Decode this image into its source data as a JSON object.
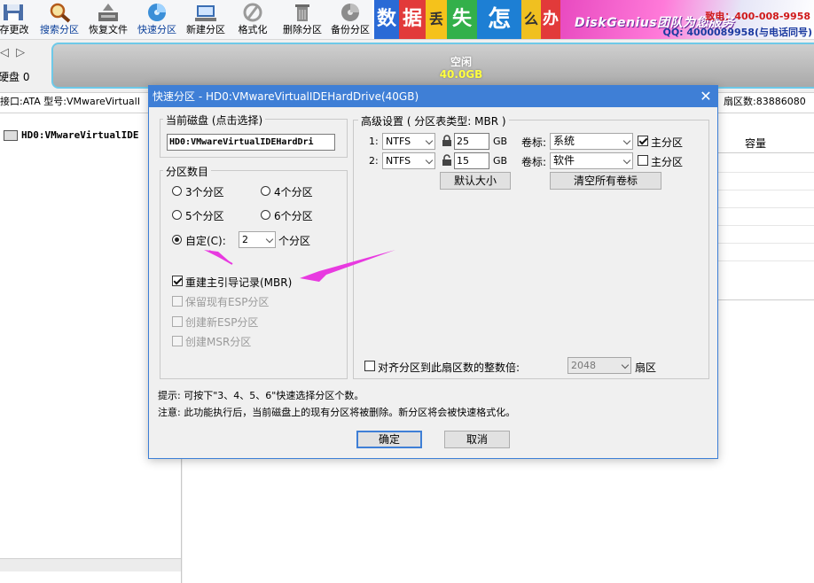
{
  "toolbar": {
    "items": [
      {
        "label": "存更改",
        "icon": "save-icon"
      },
      {
        "label": "搜索分区",
        "icon": "search-icon"
      },
      {
        "label": "恢复文件",
        "icon": "recover-icon"
      },
      {
        "label": "快速分区",
        "icon": "quick-partition-icon"
      },
      {
        "label": "新建分区",
        "icon": "new-partition-icon"
      },
      {
        "label": "格式化",
        "icon": "format-icon"
      },
      {
        "label": "删除分区",
        "icon": "delete-icon"
      },
      {
        "label": "备份分区",
        "icon": "backup-icon"
      }
    ]
  },
  "banner": {
    "tiles": [
      "数",
      "据",
      "丢",
      "失",
      "怎",
      "么",
      "办",
      "！"
    ],
    "brand": "DiskGenius团队为您服务",
    "phone_line1": "致电：400-008-9958",
    "phone_line2": "QQ: 4000089958(与电话同号)"
  },
  "disk_bar": {
    "nav_arrows": "◁ ▷",
    "disk_label": "硬盘 0",
    "free_label": "空闲",
    "free_size": "40.0GB"
  },
  "info_bar": {
    "left": "接口:ATA  型号:VMwareVirtualI",
    "right": "扇区数:83886080"
  },
  "tree": {
    "item": "HD0:VMwareVirtualIDE"
  },
  "grid": {
    "column_capacity": "容量"
  },
  "dialog": {
    "title": "快速分区 - HD0:VMwareVirtualIDEHardDrive(40GB)",
    "current_disk_group": "当前磁盘 (点击选择)",
    "current_disk_value": "HD0:VMwareVirtualIDEHardDri",
    "count_group": "分区数目",
    "radio_3": "3个分区",
    "radio_4": "4个分区",
    "radio_5": "5个分区",
    "radio_6": "6个分区",
    "radio_custom": "自定(C):",
    "custom_count": "2",
    "custom_suffix": "个分区",
    "chk_rebuild_mbr": "重建主引导记录(MBR)",
    "chk_keep_esp": "保留现有ESP分区",
    "chk_new_esp": "创建新ESP分区",
    "chk_msr": "创建MSR分区",
    "advanced_group": "高级设置 ( 分区表类型: MBR )",
    "partitions": [
      {
        "index": "1:",
        "fs": "NTFS",
        "size": "25",
        "unit": "GB",
        "label_caption": "卷标:",
        "label": "系统",
        "primary": "主分区",
        "primary_checked": true
      },
      {
        "index": "2:",
        "fs": "NTFS",
        "size": "15",
        "unit": "GB",
        "label_caption": "卷标:",
        "label": "软件",
        "primary": "主分区",
        "primary_checked": false
      }
    ],
    "default_size_btn": "默认大小",
    "clear_labels_btn": "清空所有卷标",
    "align_label": "对齐分区到此扇区数的整数倍:",
    "align_value": "2048",
    "align_unit": "扇区",
    "hint": "提示: 可按下\"3、4、5、6\"快速选择分区个数。",
    "note": "注意: 此功能执行后，当前磁盘上的现有分区将被删除。新分区将会被快速格式化。",
    "ok": "确定",
    "cancel": "取消"
  },
  "colors": {
    "title_bar": "#3f7fd6",
    "annotation_arrow": "#e83ae0",
    "disk_border": "#6ec9e8",
    "free_size_text": "#ffff40"
  }
}
